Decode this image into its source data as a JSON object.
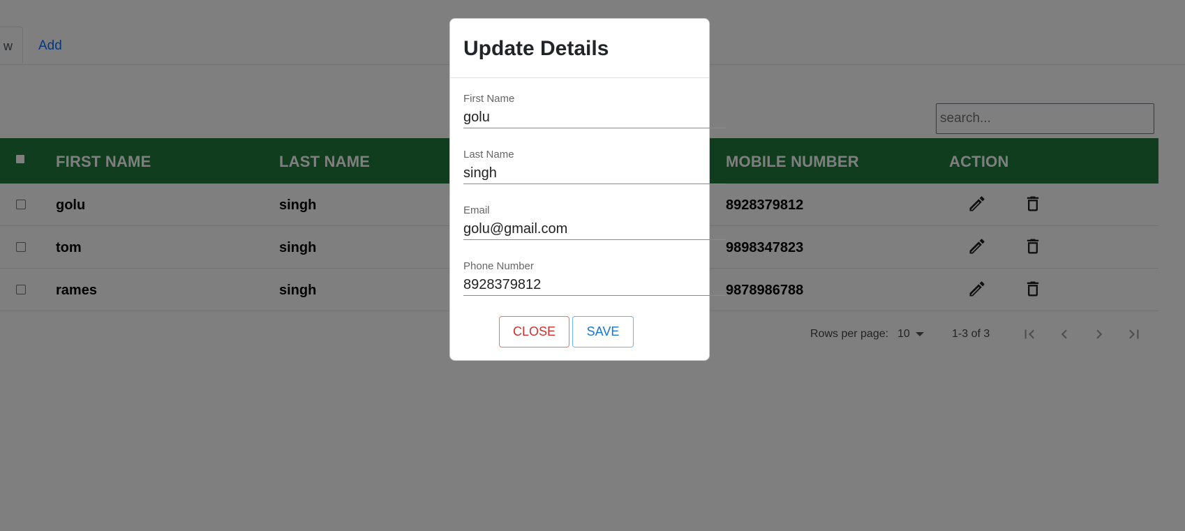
{
  "tabs": {
    "view_label": "w",
    "add_label": "Add"
  },
  "search": {
    "placeholder": "search..."
  },
  "table": {
    "headers": {
      "first_name": "FIRST NAME",
      "last_name": "LAST NAME",
      "mobile": "MOBILE NUMBER",
      "action": "ACTION"
    },
    "rows": [
      {
        "first_name": "golu",
        "last_name": "singh",
        "mobile": "8928379812"
      },
      {
        "first_name": "tom",
        "last_name": "singh",
        "mobile": "9898347823"
      },
      {
        "first_name": "rames",
        "last_name": "singh",
        "mobile": "9878986788"
      }
    ],
    "header_color": "#1f7a3c"
  },
  "pagination": {
    "rows_per_page_label": "Rows per page:",
    "rows_per_page_value": "10",
    "range": "1-3 of 3"
  },
  "modal": {
    "title": "Update Details",
    "fields": {
      "first_name": {
        "label": "First Name",
        "value": "golu"
      },
      "last_name": {
        "label": "Last Name",
        "value": "singh"
      },
      "email": {
        "label": "Email",
        "value": "golu@gmail.com"
      },
      "phone": {
        "label": "Phone Number",
        "value": "8928379812"
      }
    },
    "close_label": "CLOSE",
    "save_label": "SAVE"
  },
  "icons": {
    "edit": "pencil-icon",
    "delete": "trash-icon"
  }
}
